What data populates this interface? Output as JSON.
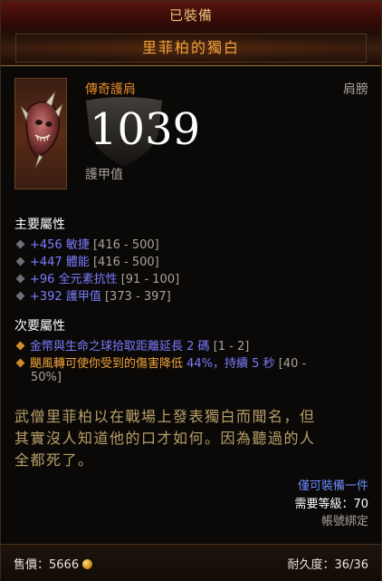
{
  "header": {
    "equipped_label": "已裝備",
    "item_name": "里菲柏的獨白"
  },
  "item": {
    "type": "傳奇護肩",
    "slot": "肩膀",
    "armor_value": "1039",
    "armor_label": "護甲值",
    "icon": "spiked-shoulder-icon"
  },
  "primary": {
    "title": "主要屬性",
    "stats": [
      {
        "text": "+456 敏捷",
        "range": "[416 - 500]"
      },
      {
        "text": "+447 體能",
        "range": "[416 - 500]"
      },
      {
        "text": "+96 全元素抗性",
        "range": "[91 - 100]"
      },
      {
        "text": "+392 護甲值",
        "range": "[373 - 397]"
      }
    ]
  },
  "secondary": {
    "title": "次要屬性",
    "stats": [
      {
        "text": "金幣與生命之球拾取距離延長 2 碼",
        "range": "[1 - 2]"
      },
      {
        "text_a": "颶風轉可使你受到的傷害降低",
        "text_b": "44%，持續 5 秒",
        "range_a": "[40 -",
        "range_b": "50%]"
      }
    ]
  },
  "flavor": {
    "line1": "武僧里菲柏以在戰場上發表獨白而聞名，但",
    "line2": "其實沒人知道他的口才如何。因為聽過的人",
    "line3": "全都死了。"
  },
  "requirements": {
    "class_restrict": "僅可裝備一件",
    "level_req": "需要等級：70",
    "account_bound": "帳號綁定"
  },
  "footer": {
    "sell_label": "售價：5666",
    "durability": "耐久度：36/36"
  },
  "colors": {
    "item_name": "#f0a33a",
    "magic_stat": "#7b7bff",
    "legendary_affix_bullet": "#d28a28"
  }
}
